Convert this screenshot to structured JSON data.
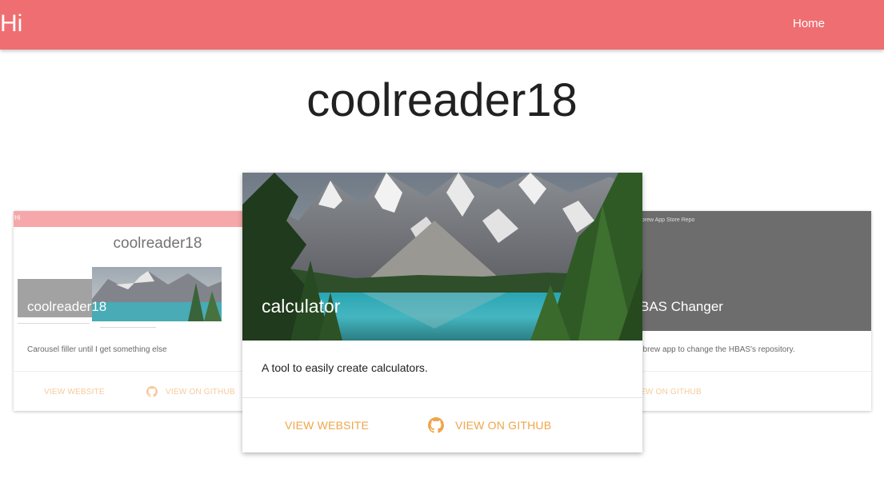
{
  "navbar": {
    "brand": "Hi",
    "home_link": "Home"
  },
  "page": {
    "title": "coolreader18"
  },
  "carousel": {
    "left_card": {
      "media_caption": {
        "nav_text": "Hi",
        "title": "coolreader18"
      },
      "title": "coolreader18",
      "description": "Carousel filler until I get something else",
      "view_website": "VIEW WEBSITE",
      "view_github": "VIEW ON GITHUB"
    },
    "center_card": {
      "title": "calculator",
      "description": "A tool to easily create calculators.",
      "view_website": "VIEW WEBSITE",
      "view_github": "VIEW ON GITHUB"
    },
    "right_card": {
      "media_caption": "ebrew App Store Repo",
      "title": "BAS Changer",
      "description": "ebrew app to change the HBAS's repository.",
      "view_github": "EW ON GITHUB"
    }
  },
  "colors": {
    "navbar": "#ef6e71",
    "accent": "#f0a54a"
  },
  "icons": [
    "github-icon"
  ]
}
